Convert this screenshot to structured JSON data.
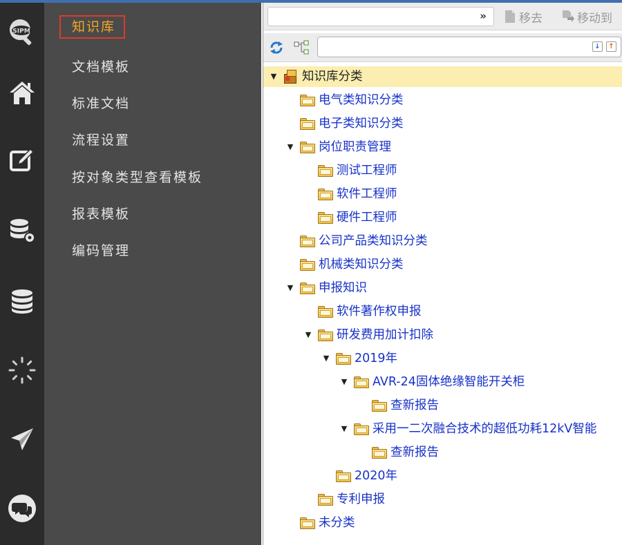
{
  "rail": {
    "items": [
      {
        "name": "sipm-logo-icon",
        "label": "SIPM"
      },
      {
        "name": "home-icon"
      },
      {
        "name": "edit-icon"
      },
      {
        "name": "database-settings-icon"
      },
      {
        "name": "database-icon"
      },
      {
        "name": "loading-spinner-icon"
      },
      {
        "name": "send-icon"
      },
      {
        "name": "chat-icon"
      }
    ]
  },
  "menu": {
    "items": [
      {
        "label": "知识库",
        "active": true
      },
      {
        "label": "文档模板"
      },
      {
        "label": "标准文档"
      },
      {
        "label": "流程设置"
      },
      {
        "label": "按对象类型查看模板"
      },
      {
        "label": "报表模板"
      },
      {
        "label": "编码管理"
      }
    ]
  },
  "toolbar": {
    "remove_label": "移去",
    "move_label": "移动到"
  },
  "search": {
    "value": "",
    "placeholder": ""
  },
  "colors": {
    "rail_bg": "#2b2b2b",
    "menu_bg": "#4a4a4a",
    "active_text": "#f5a623",
    "active_border": "#e03a2a",
    "tree_link": "#1732c9",
    "root_highlight": "#fbeeb0"
  },
  "tree": {
    "root": "知识库分类",
    "nodes": [
      {
        "label": "电气类知识分类"
      },
      {
        "label": "电子类知识分类"
      },
      {
        "label": "岗位职责管理",
        "expanded": true
      },
      {
        "label": "测试工程师"
      },
      {
        "label": "软件工程师"
      },
      {
        "label": "硬件工程师"
      },
      {
        "label": "公司产品类知识分类"
      },
      {
        "label": "机械类知识分类"
      },
      {
        "label": "申报知识",
        "expanded": true
      },
      {
        "label": "软件著作权申报"
      },
      {
        "label": "研发费用加计扣除",
        "expanded": true
      },
      {
        "label": "2019年",
        "expanded": true
      },
      {
        "label": "AVR-24固体绝缘智能开关柜",
        "expanded": true
      },
      {
        "label": "查新报告"
      },
      {
        "label": "采用一二次融合技术的超低功耗12kV智能",
        "expanded": true
      },
      {
        "label": "查新报告"
      },
      {
        "label": "2020年"
      },
      {
        "label": "专利申报"
      },
      {
        "label": "未分类"
      }
    ]
  }
}
